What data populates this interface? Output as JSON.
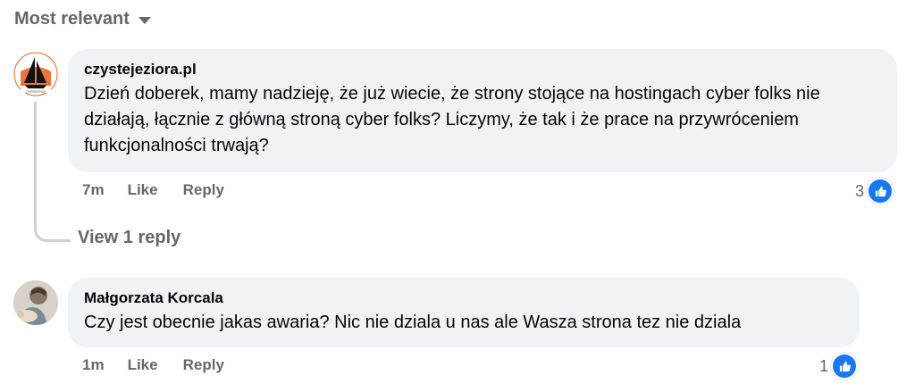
{
  "sort": {
    "label": "Most relevant",
    "icon": "caret-down-icon"
  },
  "comments": [
    {
      "author": "czystejeziora.pl",
      "avatar_text": "czystejeziora.pl",
      "text": "Dzień doberek, mamy nadzieję, że już wiecie, że strony stojące na hostingach cyber folks nie działają, łącznie z główną stroną cyber folks? Liczymy, że tak i że prace na przywróceniem funkcjonalności trwają?",
      "time": "7m",
      "like_label": "Like",
      "reply_label": "Reply",
      "reaction_count": "3",
      "reaction_icon": "like-icon"
    },
    {
      "author": "Małgorzata Korcala",
      "text": "Czy jest obecnie jakas awaria? Nic nie dziala u nas ale Wasza strona tez nie dziala",
      "time": "1m",
      "like_label": "Like",
      "reply_label": "Reply",
      "reaction_count": "1",
      "reaction_icon": "like-icon"
    }
  ],
  "view_replies": "View 1 reply",
  "colors": {
    "bubble": "#f0f2f5",
    "secondary_text": "#65676b",
    "like_blue": "#1877f2",
    "logo_orange": "#e8672a"
  }
}
